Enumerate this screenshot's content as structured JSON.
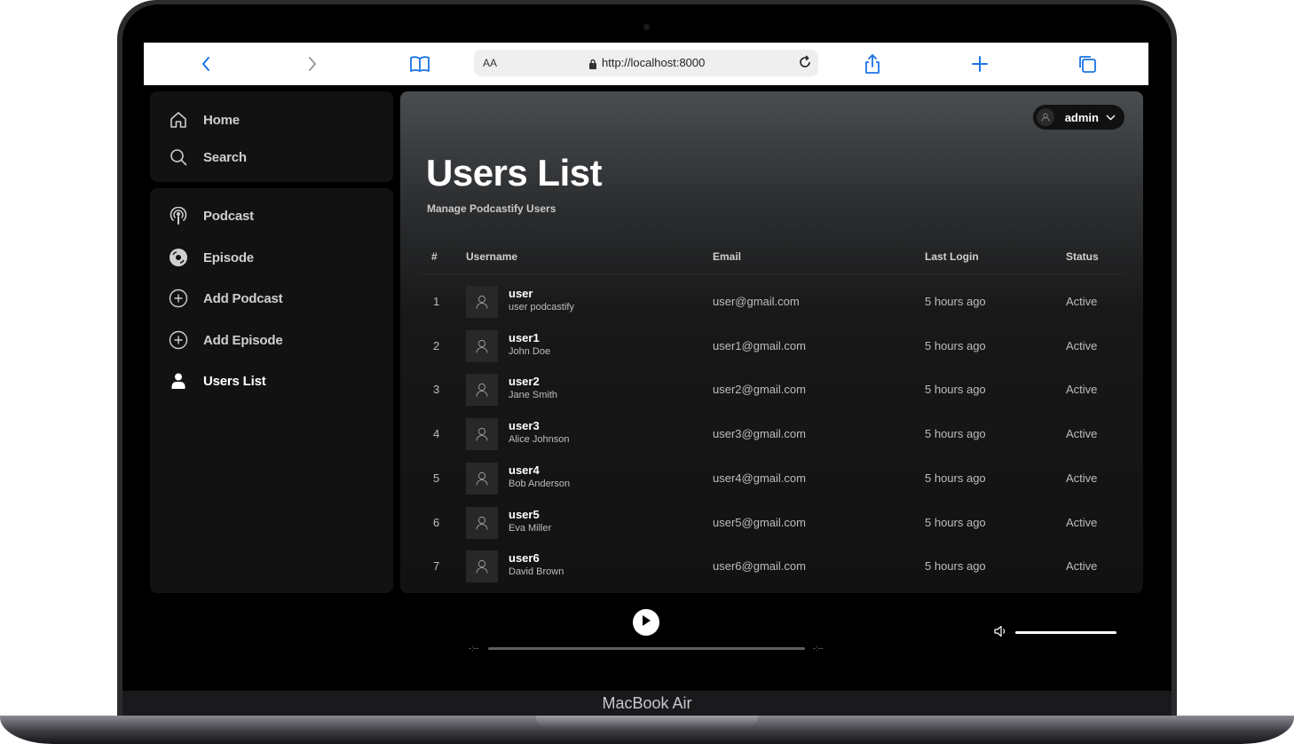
{
  "device": {
    "label": "MacBook Air"
  },
  "browser": {
    "text_size_label": "AA",
    "url": "http://localhost:8000",
    "icons": [
      "back-icon",
      "forward-icon",
      "bookmarks-icon",
      "lock-icon",
      "reload-icon",
      "share-icon",
      "new-tab-icon",
      "tabs-icon"
    ]
  },
  "sidebar": {
    "top_items": [
      {
        "label": "Home",
        "icon": "home-icon"
      },
      {
        "label": "Search",
        "icon": "search-icon"
      }
    ],
    "library_items": [
      {
        "label": "Podcast",
        "icon": "podcast-icon"
      },
      {
        "label": "Episode",
        "icon": "episode-icon"
      },
      {
        "label": "Add Podcast",
        "icon": "plus-circle-icon"
      },
      {
        "label": "Add Episode",
        "icon": "plus-circle-icon"
      },
      {
        "label": "Users List",
        "icon": "person-icon",
        "active": true
      }
    ]
  },
  "header": {
    "account_name": "admin"
  },
  "page": {
    "title": "Users List",
    "subtitle": "Manage Podcastify Users"
  },
  "table": {
    "columns": [
      "#",
      "Username",
      "Email",
      "Last Login",
      "Status"
    ],
    "rows": [
      {
        "num": "1",
        "username": "user",
        "full_name": "user podcastify",
        "email": "user@gmail.com",
        "last_login": "5 hours ago",
        "status": "Active"
      },
      {
        "num": "2",
        "username": "user1",
        "full_name": "John Doe",
        "email": "user1@gmail.com",
        "last_login": "5 hours ago",
        "status": "Active"
      },
      {
        "num": "3",
        "username": "user2",
        "full_name": "Jane Smith",
        "email": "user2@gmail.com",
        "last_login": "5 hours ago",
        "status": "Active"
      },
      {
        "num": "4",
        "username": "user3",
        "full_name": "Alice Johnson",
        "email": "user3@gmail.com",
        "last_login": "5 hours ago",
        "status": "Active"
      },
      {
        "num": "5",
        "username": "user4",
        "full_name": "Bob Anderson",
        "email": "user4@gmail.com",
        "last_login": "5 hours ago",
        "status": "Active"
      },
      {
        "num": "6",
        "username": "user5",
        "full_name": "Eva Miller",
        "email": "user5@gmail.com",
        "last_login": "5 hours ago",
        "status": "Active"
      },
      {
        "num": "7",
        "username": "user6",
        "full_name": "David Brown",
        "email": "user6@gmail.com",
        "last_login": "5 hours ago",
        "status": "Active"
      }
    ]
  },
  "player": {
    "elapsed": "-:--",
    "duration": "-:--",
    "progress": 0,
    "volume": 1.0
  },
  "colors": {
    "accent": "#1a73e8",
    "panel": "#121212",
    "text": "#ffffff",
    "muted_text": "#bdbdbd"
  }
}
